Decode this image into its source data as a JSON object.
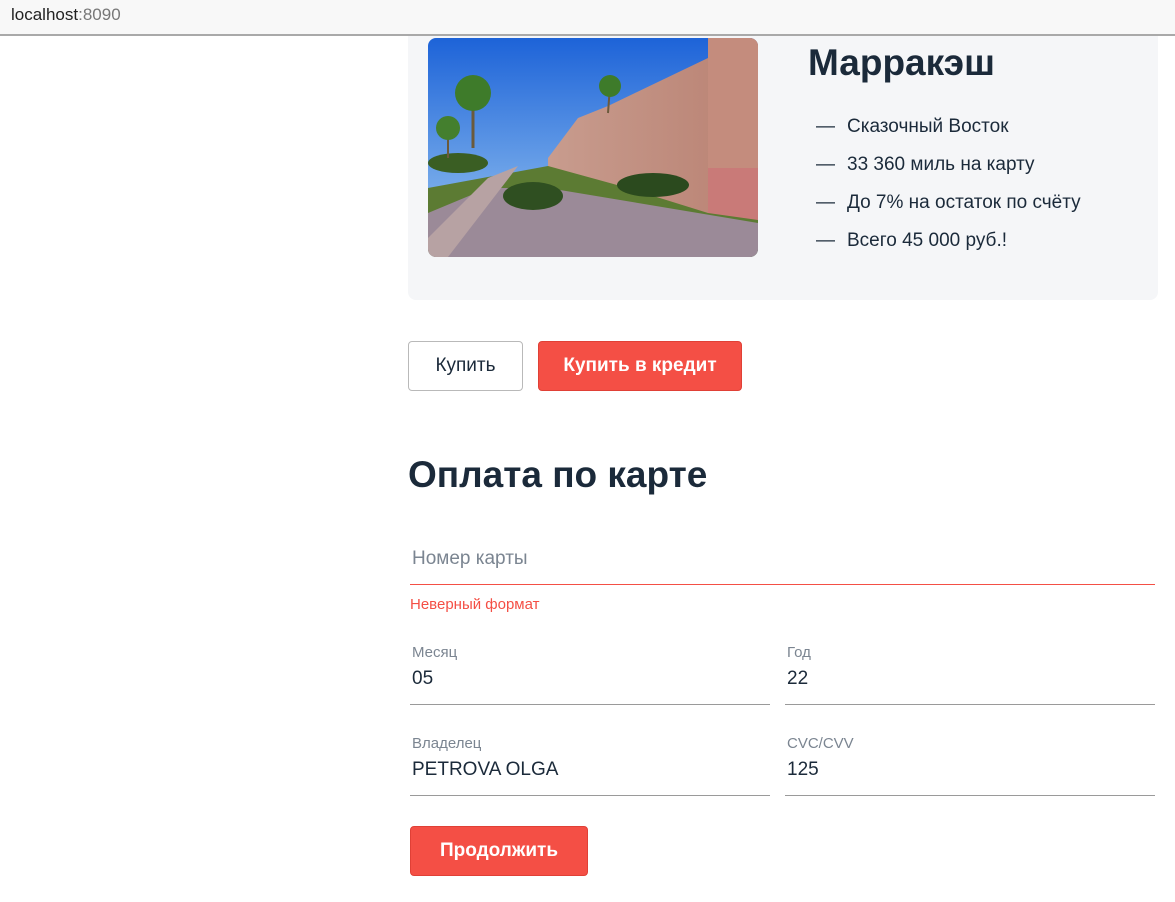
{
  "browser": {
    "host": "localhost",
    "port": ":8090"
  },
  "tour": {
    "city": "Марракэш",
    "features": [
      {
        "dash": "—",
        "text": "Сказочный Восток"
      },
      {
        "dash": "—",
        "text": "33 360 миль на карту"
      },
      {
        "dash": "—",
        "text": "До 7% на остаток по счёту"
      },
      {
        "dash": "—",
        "text": "Всего 45 000 руб.!"
      }
    ]
  },
  "actions": {
    "buy_label": "Купить",
    "credit_label": "Купить в кредит"
  },
  "payment": {
    "title": "Оплата по карте",
    "card_number": {
      "placeholder": "Номер карты",
      "value": "",
      "error": "Неверный формат"
    },
    "month": {
      "label": "Месяц",
      "value": "05"
    },
    "year": {
      "label": "Год",
      "value": "22"
    },
    "owner": {
      "label": "Владелец",
      "value": "PETROVA OLGA"
    },
    "cvc": {
      "label": "CVC/CVV",
      "value": "125"
    },
    "continue_label": "Продолжить"
  },
  "colors": {
    "accent": "#f44f45",
    "text": "#1b2a3a",
    "card_bg": "#f5f6f8"
  }
}
